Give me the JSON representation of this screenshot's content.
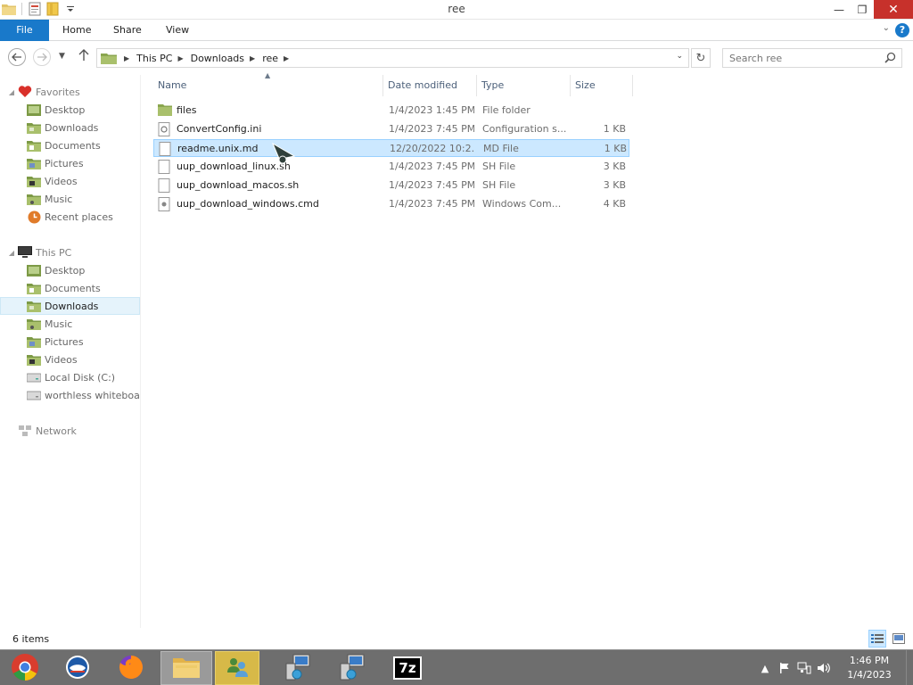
{
  "window": {
    "title": "ree",
    "minimize": "—",
    "restore": "❐",
    "close": "✕"
  },
  "ribbon": {
    "tabs": [
      "File",
      "Home",
      "Share",
      "View"
    ],
    "help": "?"
  },
  "nav": {
    "breadcrumb": [
      "This PC",
      "Downloads",
      "ree"
    ],
    "search_placeholder": "Search ree"
  },
  "navpane": {
    "favorites_label": "Favorites",
    "favorites": [
      "Desktop",
      "Downloads",
      "Documents",
      "Pictures",
      "Videos",
      "Music",
      "Recent places"
    ],
    "thispc_label": "This PC",
    "thispc": [
      "Desktop",
      "Documents",
      "Downloads",
      "Music",
      "Pictures",
      "Videos",
      "Local Disk (C:)",
      "worthless whiteboa"
    ],
    "network_label": "Network",
    "selected": "Downloads"
  },
  "columns": {
    "name": "Name",
    "date": "Date modified",
    "type": "Type",
    "size": "Size"
  },
  "files": [
    {
      "name": "files",
      "date": "1/4/2023 1:45 PM",
      "type": "File folder",
      "size": "",
      "icon": "folder-icon"
    },
    {
      "name": "ConvertConfig.ini",
      "date": "1/4/2023 7:45 PM",
      "type": "Configuration s...",
      "size": "1 KB",
      "icon": "config-file-icon"
    },
    {
      "name": "readme.unix.md",
      "date": "12/20/2022 10:2...",
      "type": "MD File",
      "size": "1 KB",
      "icon": "file-icon",
      "selected": true
    },
    {
      "name": "uup_download_linux.sh",
      "date": "1/4/2023 7:45 PM",
      "type": "SH File",
      "size": "3 KB",
      "icon": "file-icon"
    },
    {
      "name": "uup_download_macos.sh",
      "date": "1/4/2023 7:45 PM",
      "type": "SH File",
      "size": "3 KB",
      "icon": "file-icon"
    },
    {
      "name": "uup_download_windows.cmd",
      "date": "1/4/2023 7:45 PM",
      "type": "Windows Com...",
      "size": "4 KB",
      "icon": "cmd-file-icon"
    }
  ],
  "status": {
    "count": "6 items"
  },
  "taskbar": {
    "apps": [
      "chrome-icon",
      "outlook-icon",
      "firefox-icon",
      "file-explorer-icon",
      "user-accounts-icon",
      "network-computer-icon",
      "network-computer-icon",
      "7zip-icon"
    ],
    "sevenzip_label": "7z",
    "time": "1:46 PM",
    "date": "1/4/2023"
  },
  "colors": {
    "accent": "#1979ca",
    "selection": "#cce8ff",
    "selection_border": "#99d1ff",
    "close_button": "#c7312b",
    "taskbar": "#6e6e6e"
  }
}
